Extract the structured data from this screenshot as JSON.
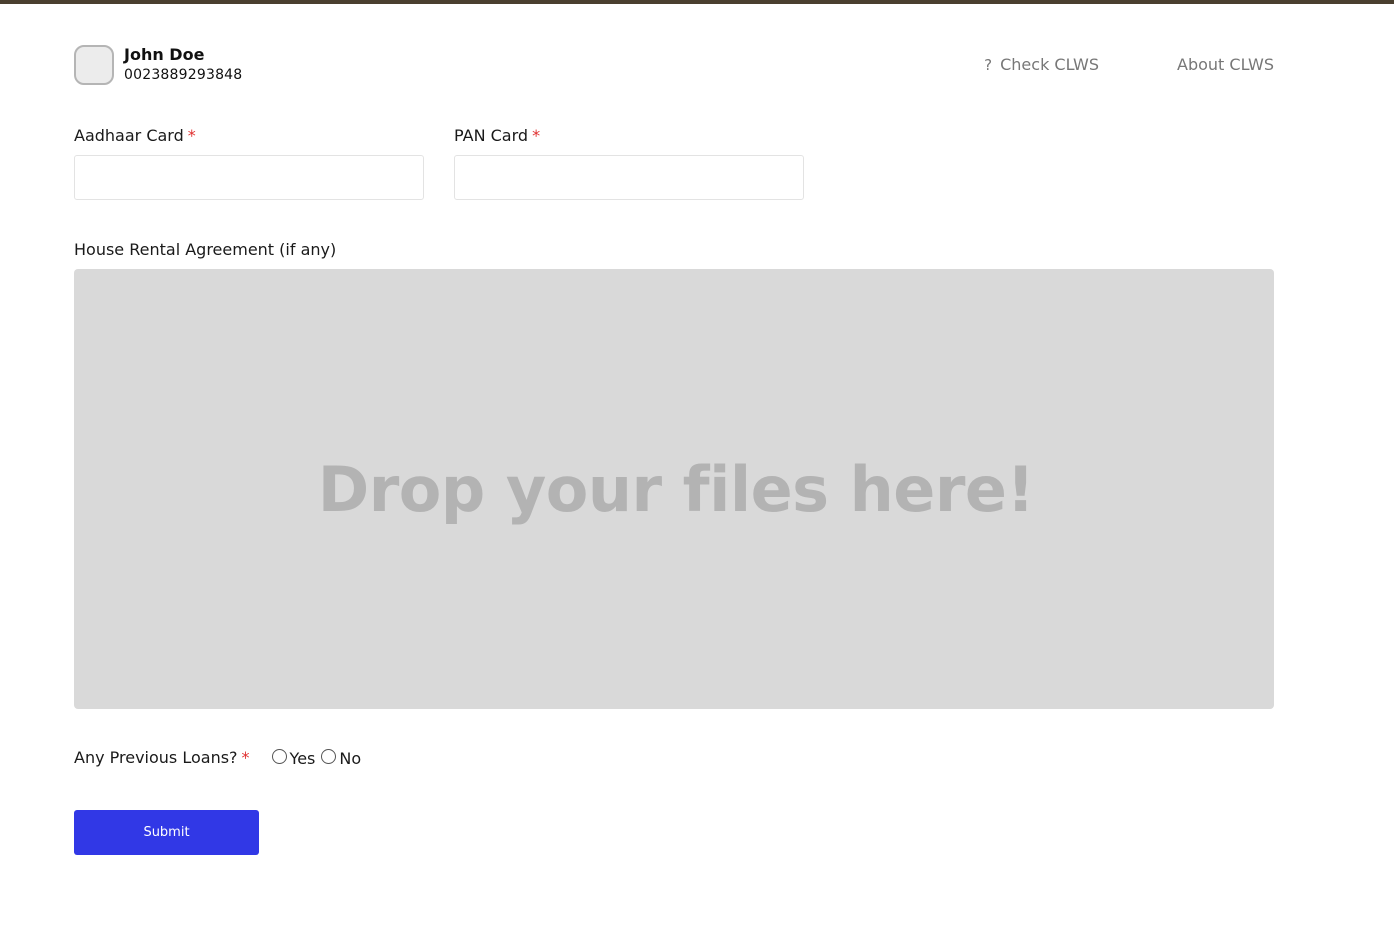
{
  "user": {
    "name": "John Doe",
    "id": "0023889293848"
  },
  "nav": {
    "help_icon": "?",
    "check_label": "Check CLWS",
    "about_label": "About CLWS"
  },
  "form": {
    "aadhaar": {
      "label": "Aadhaar Card",
      "required_mark": "*",
      "value": ""
    },
    "pan": {
      "label": "PAN Card",
      "required_mark": "*",
      "value": ""
    },
    "rental": {
      "label": "House Rental Agreement (if any)",
      "dropzone_text": "Drop your files here!"
    },
    "loans": {
      "label": "Any Previous Loans?",
      "required_mark": "*",
      "options": [
        "Yes",
        "No"
      ],
      "selected": null
    },
    "submit_label": "Submit"
  },
  "colors": {
    "top_border": "#4a3f2f",
    "required": "#e03030",
    "submit_bg": "#3138e6",
    "dropzone_bg": "#d9d9d9",
    "dropzone_text": "#b3b3b3",
    "nav_text": "#777777"
  }
}
